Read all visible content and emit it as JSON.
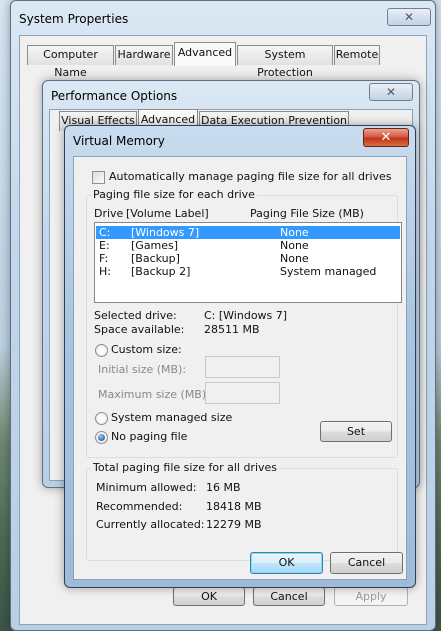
{
  "system_properties": {
    "title": "System Properties",
    "tabs": [
      "Computer Name",
      "Hardware",
      "Advanced",
      "System Protection",
      "Remote"
    ],
    "active_tab": "Advanced",
    "buttons": {
      "ok": "OK",
      "cancel": "Cancel",
      "apply": "Apply"
    }
  },
  "performance_options": {
    "title": "Performance Options",
    "tabs": [
      "Visual Effects",
      "Advanced",
      "Data Execution Prevention"
    ]
  },
  "virtual_memory": {
    "title": "Virtual Memory",
    "auto_manage_label": "Automatically manage paging file size for all drives",
    "auto_manage_checked": false,
    "group_label": "Paging file size for each drive",
    "columns": {
      "drive": "Drive",
      "volume": "[Volume Label]",
      "size": "Paging File Size (MB)"
    },
    "drives": [
      {
        "drive": "C:",
        "volume": "[Windows 7]",
        "size": "None",
        "selected": true
      },
      {
        "drive": "E:",
        "volume": "[Games]",
        "size": "None",
        "selected": false
      },
      {
        "drive": "F:",
        "volume": "[Backup]",
        "size": "None",
        "selected": false
      },
      {
        "drive": "H:",
        "volume": "[Backup 2]",
        "size": "System managed",
        "selected": false
      }
    ],
    "selected_drive_label": "Selected drive:",
    "selected_drive_value": "C:  [Windows 7]",
    "space_available_label": "Space available:",
    "space_available_value": "28511 MB",
    "custom_size_label": "Custom size:",
    "initial_size_label": "Initial size (MB):",
    "initial_size_value": "",
    "maximum_size_label": "Maximum size (MB):",
    "maximum_size_value": "",
    "system_managed_label": "System managed size",
    "no_paging_label": "No paging file",
    "selected_option": "no_paging",
    "set_button": "Set",
    "totals_label": "Total paging file size for all drives",
    "min_allowed_label": "Minimum allowed:",
    "min_allowed_value": "16 MB",
    "recommended_label": "Recommended:",
    "recommended_value": "18418 MB",
    "currently_allocated_label": "Currently allocated:",
    "currently_allocated_value": "12279 MB",
    "ok_button": "OK",
    "cancel_button": "Cancel"
  },
  "icons": {
    "close": "close-icon"
  },
  "colors": {
    "selection": "#3399ff",
    "close_button": "#c2311b"
  }
}
